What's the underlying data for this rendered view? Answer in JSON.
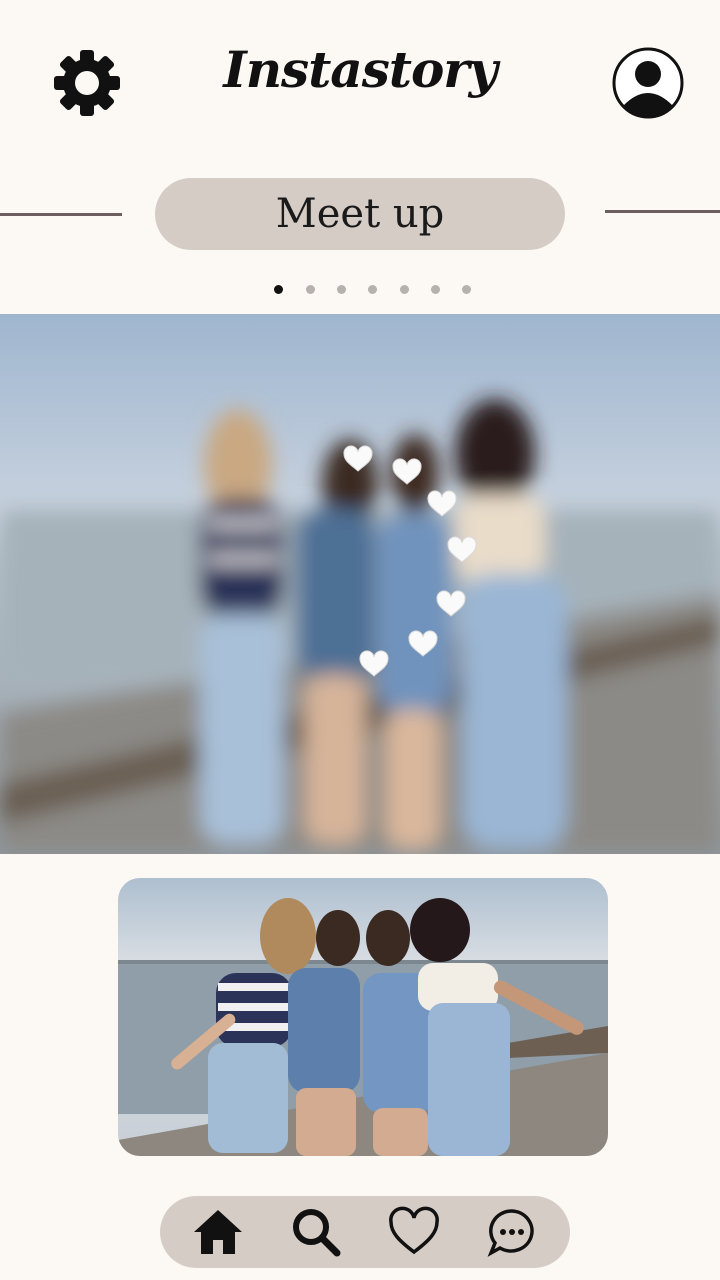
{
  "header": {
    "app_title": "Instastory",
    "settings_icon": "gear-icon",
    "profile_icon": "user-avatar-icon"
  },
  "story": {
    "title": "Meet up",
    "page_count": 7,
    "active_page": 1
  },
  "photos": {
    "main": "blurred group photo of four friends on a pier",
    "main_overlay": "floating heart stickers",
    "thumbnail": "four friends posing on a wooden pier by the water"
  },
  "bottom_nav": {
    "items": [
      "home-icon",
      "search-icon",
      "heart-icon",
      "chat-icon"
    ]
  },
  "colors": {
    "background": "#fcf8f4",
    "pill": "#d6ccc6",
    "text": "#111111"
  }
}
